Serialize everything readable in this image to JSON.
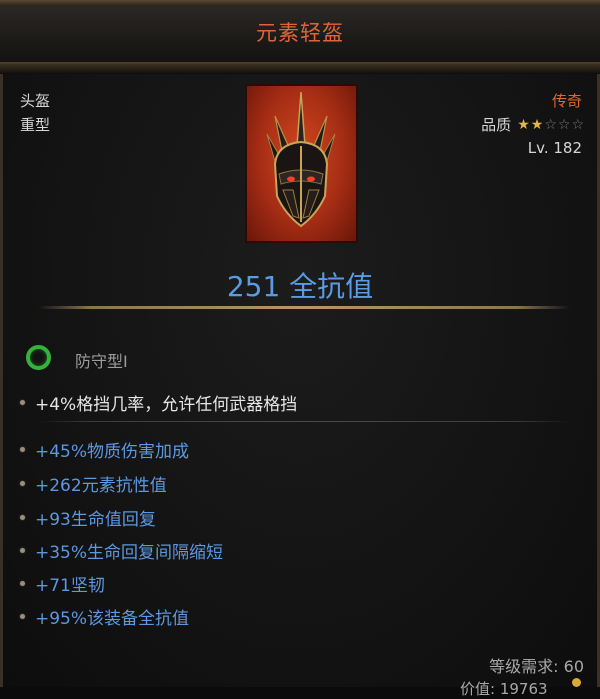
{
  "item": {
    "name": "元素轻盔",
    "slot": "头盔",
    "weight_class": "重型",
    "rarity": "传奇",
    "quality_label": "品质",
    "quality_stars": 2,
    "quality_max": 5,
    "level": "Lv. 182",
    "resist_value": "251 全抗值",
    "icon": "dark-helmet-icon"
  },
  "set_bonus": {
    "name": "防守型I",
    "icon": "green-ring-icon"
  },
  "affixes_implicit": [
    "+4%格挡几率，允许任何武器格挡"
  ],
  "affixes": [
    "+45%物质伤害加成",
    "+262元素抗性值",
    "+93生命值回复",
    "+35%生命回复间隔缩短",
    "+71坚韧",
    "+95%该装备全抗值"
  ],
  "footer": {
    "level_requirement": "等级需求: 60",
    "price": "价值: 19763"
  },
  "colors": {
    "title": "#e0643a",
    "rarity": "#e2692c",
    "affix_blue": "#5d98e0",
    "value_blue": "#5a9be6",
    "set_green": "#34b23a"
  }
}
